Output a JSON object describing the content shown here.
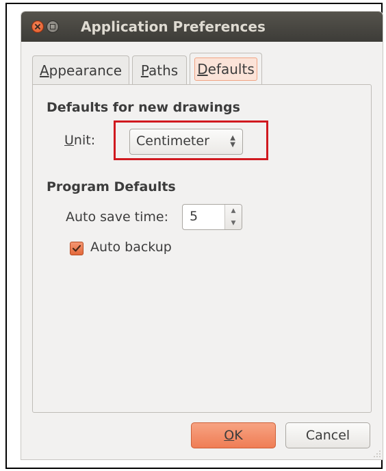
{
  "window": {
    "title": "Application Preferences",
    "close_icon": "close-icon",
    "maximize_icon": "maximize-icon"
  },
  "tabs": [
    {
      "label_mnemonic": "A",
      "label_rest": "ppearance",
      "selected": false
    },
    {
      "label_mnemonic": "P",
      "label_rest": "aths",
      "selected": false
    },
    {
      "label_mnemonic": "D",
      "label_rest": "efaults",
      "selected": true
    }
  ],
  "defaults_section": {
    "heading": "Defaults for new drawings",
    "unit_label_mnemonic": "U",
    "unit_label_rest": "nit:",
    "unit_value": "Centimeter",
    "highlight_color": "#d0191f"
  },
  "program_section": {
    "heading": "Program Defaults",
    "autosave_label": "Auto save time:",
    "autosave_value": "5",
    "autobackup_label": "Auto backup",
    "autobackup_checked": true
  },
  "buttons": {
    "ok_mnemonic": "O",
    "ok_rest": "K",
    "cancel_label": "Cancel"
  },
  "colors": {
    "accent": "#ef7d55",
    "titlebar": "#3d3c38"
  }
}
